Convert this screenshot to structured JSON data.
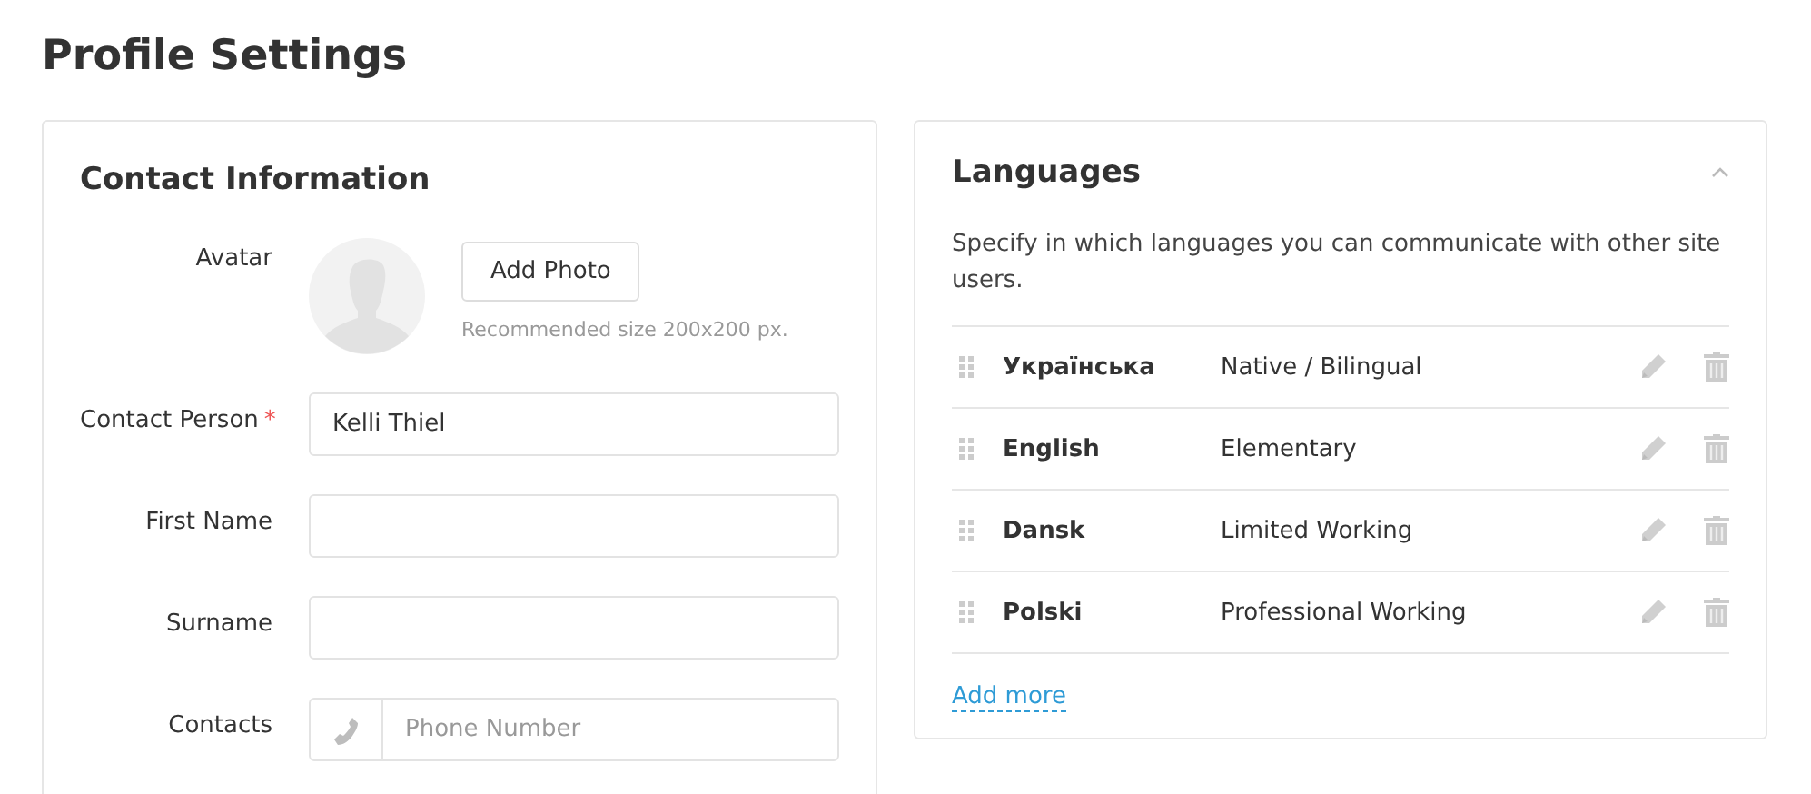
{
  "page_title": "Profile Settings",
  "contact": {
    "title": "Contact Information",
    "avatar": {
      "label": "Avatar",
      "button": "Add Photo",
      "hint": "Recommended size 200x200 px."
    },
    "required_mark": "*",
    "fields": [
      {
        "label": "Contact Person",
        "required": true,
        "value": "Kelli Thiel",
        "kind": "text"
      },
      {
        "label": "First Name",
        "required": false,
        "kind": "text"
      },
      {
        "label": "Surname",
        "required": false,
        "kind": "text"
      },
      {
        "label": "Contacts",
        "required": false,
        "placeholder": "Phone Number",
        "kind": "phone"
      }
    ]
  },
  "languages": {
    "title": "Languages",
    "expanded": true,
    "description": "Specify in which languages you can communicate with other site users.",
    "items": [
      {
        "name": "Українська",
        "level": "Native / Bilingual"
      },
      {
        "name": "English",
        "level": "Elementary"
      },
      {
        "name": "Dansk",
        "level": "Limited Working"
      },
      {
        "name": "Polski",
        "level": "Professional Working"
      }
    ],
    "add_link": "Add more"
  }
}
